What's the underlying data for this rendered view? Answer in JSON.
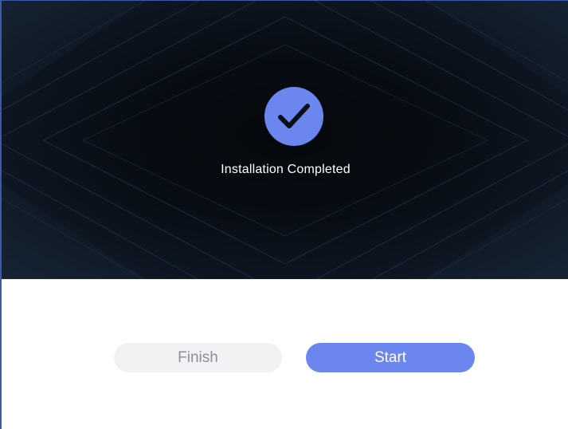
{
  "window": {
    "status_text": "Installation Completed",
    "status_icon": "checkmark-icon"
  },
  "buttons": {
    "finish_label": "Finish",
    "start_label": "Start"
  },
  "colors": {
    "accent": "#6b86ee",
    "hero_background": "#080c12",
    "secondary_button": "#f1f2f4",
    "secondary_text": "#8d9097"
  }
}
